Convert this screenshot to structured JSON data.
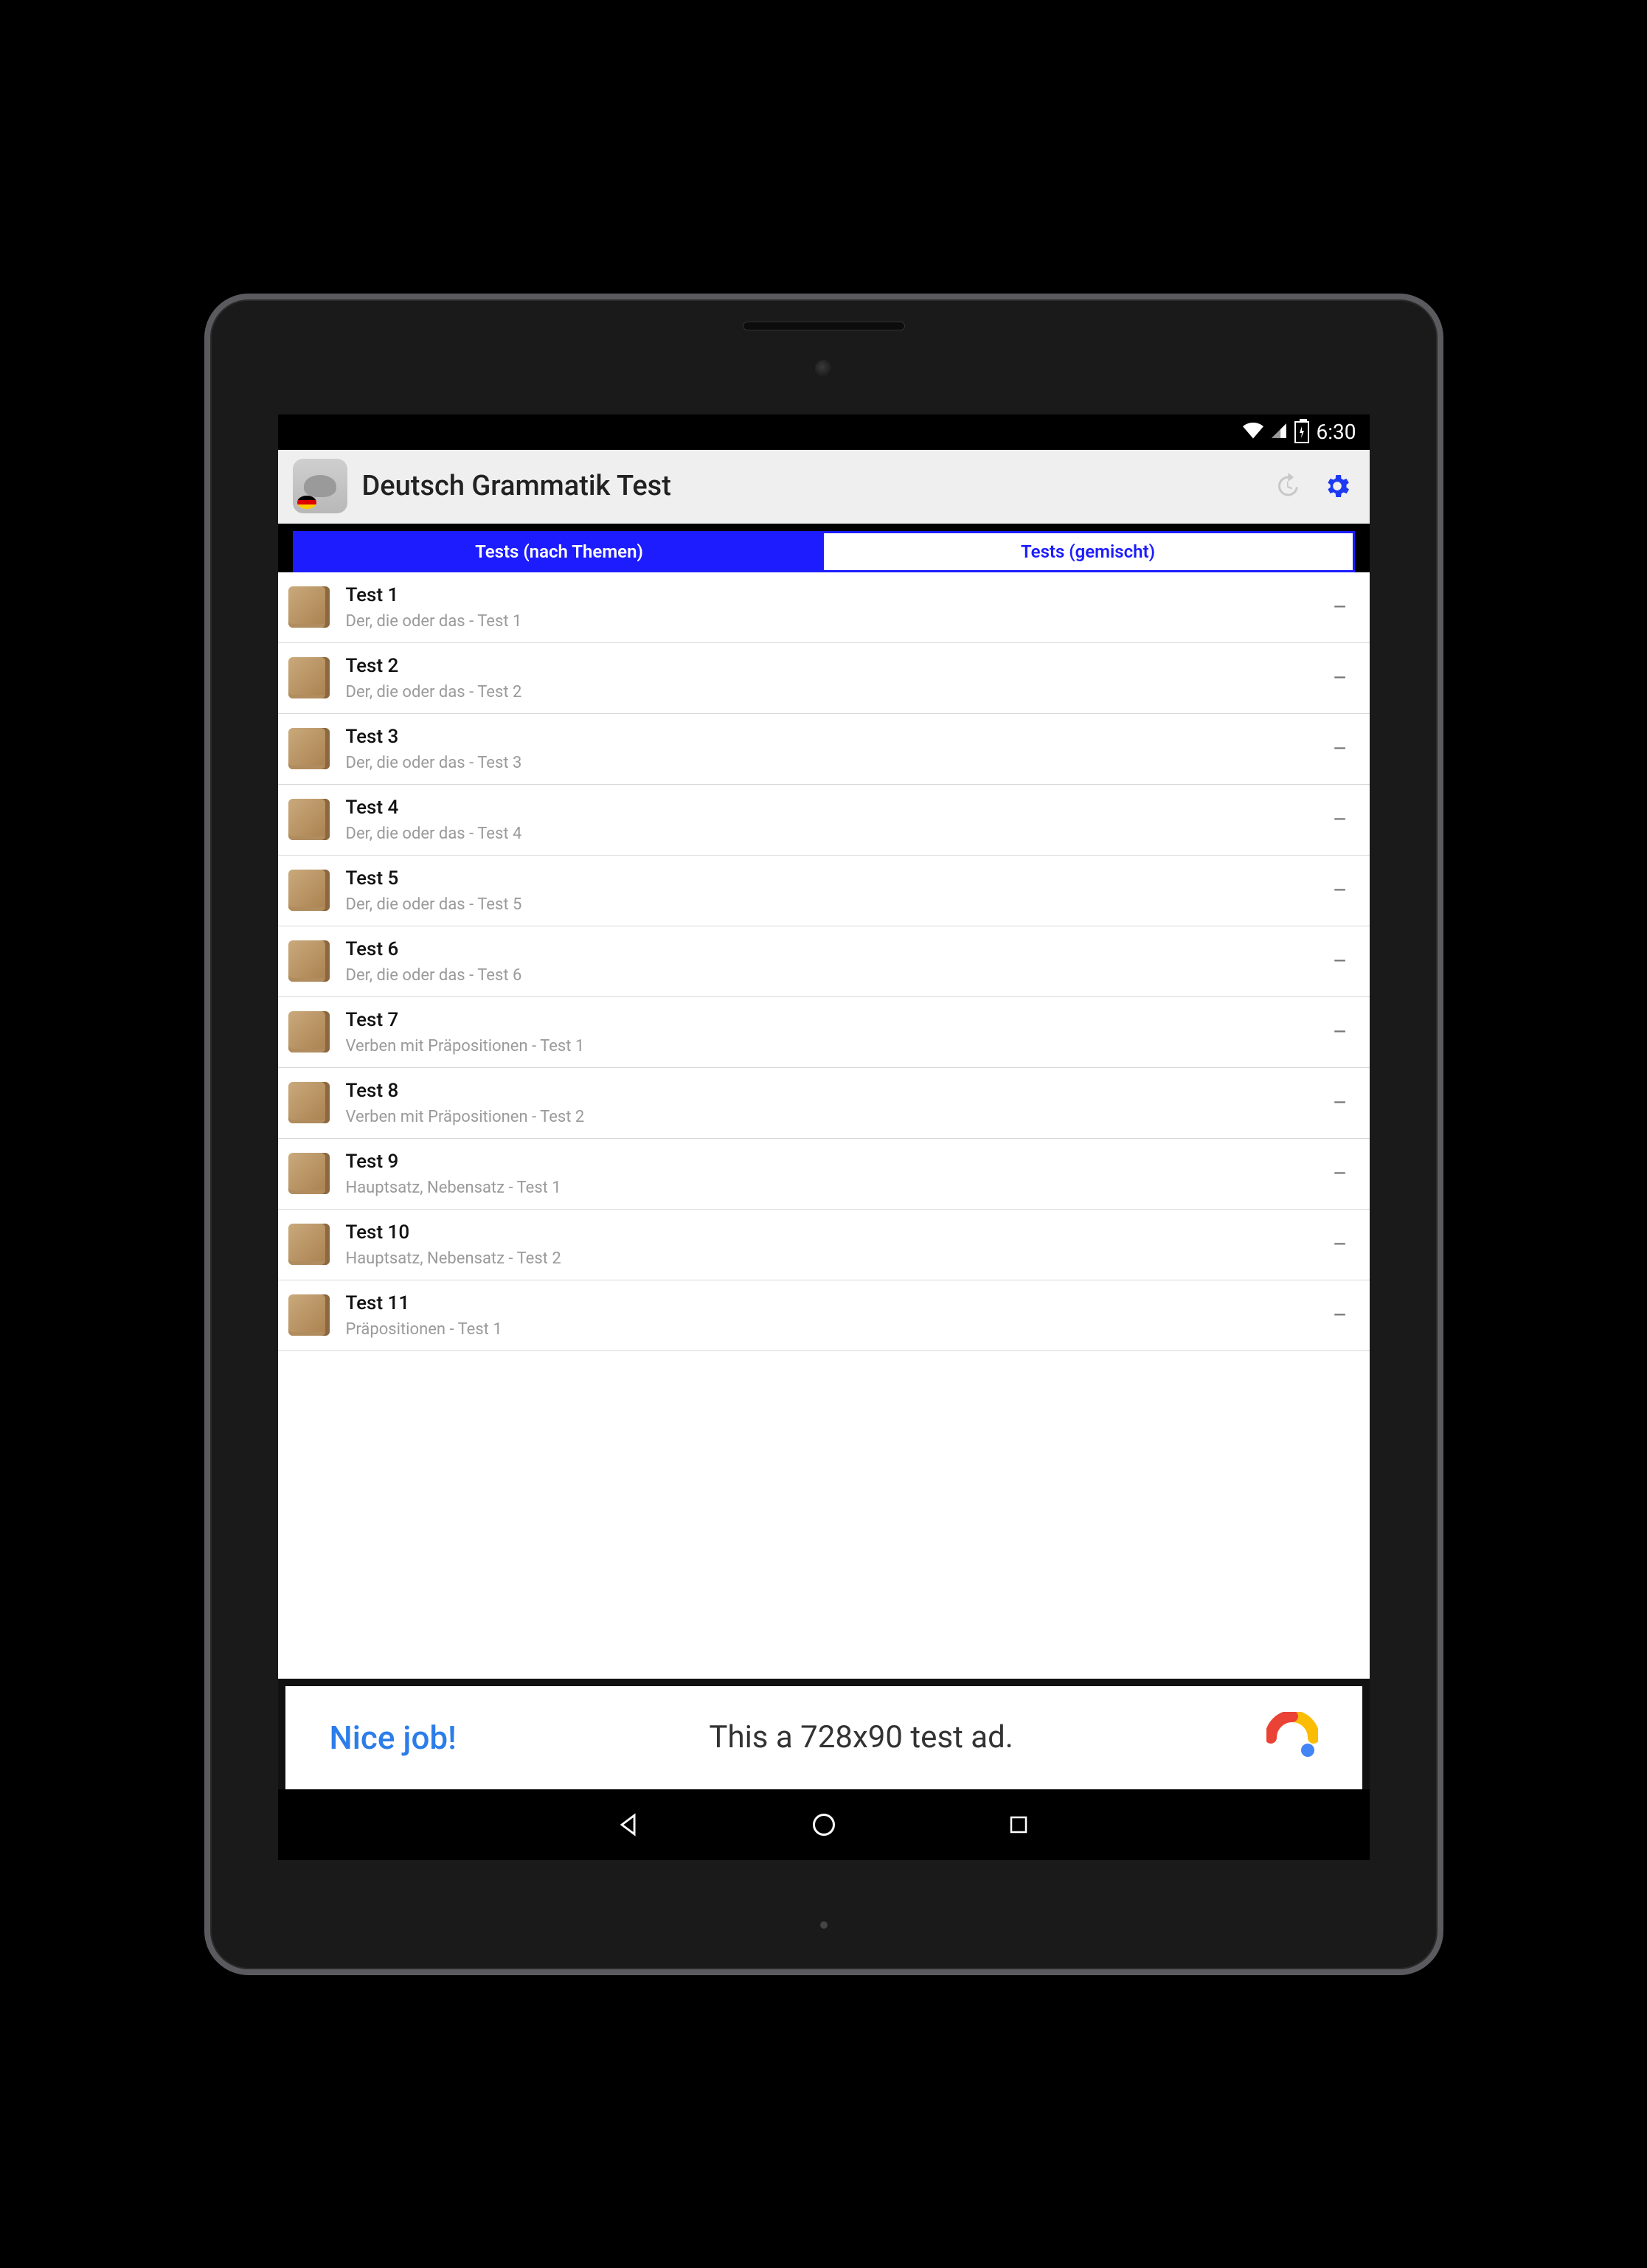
{
  "statusbar": {
    "time": "6:30"
  },
  "actionbar": {
    "title": "Deutsch Grammatik Test"
  },
  "tabs": {
    "left": "Tests (nach Themen)",
    "right": "Tests (gemischt)",
    "active_index": 0
  },
  "list": [
    {
      "title": "Test 1",
      "subtitle": "Der, die oder das - Test 1",
      "trail": "–"
    },
    {
      "title": "Test 2",
      "subtitle": "Der, die oder das - Test 2",
      "trail": "–"
    },
    {
      "title": "Test 3",
      "subtitle": "Der, die oder das - Test 3",
      "trail": "–"
    },
    {
      "title": "Test 4",
      "subtitle": "Der, die oder das - Test 4",
      "trail": "–"
    },
    {
      "title": "Test 5",
      "subtitle": "Der, die oder das - Test 5",
      "trail": "–"
    },
    {
      "title": "Test 6",
      "subtitle": "Der, die oder das - Test 6",
      "trail": "–"
    },
    {
      "title": "Test 7",
      "subtitle": "Verben mit Präpositionen - Test 1",
      "trail": "–"
    },
    {
      "title": "Test 8",
      "subtitle": "Verben mit Präpositionen - Test 2",
      "trail": "–"
    },
    {
      "title": "Test 9",
      "subtitle": "Hauptsatz, Nebensatz - Test 1",
      "trail": "–"
    },
    {
      "title": "Test 10",
      "subtitle": "Hauptsatz, Nebensatz - Test 2",
      "trail": "–"
    },
    {
      "title": "Test 11",
      "subtitle": "Präpositionen - Test 1",
      "trail": "–"
    }
  ],
  "ad": {
    "nice": "Nice job!",
    "msg": "This a 728x90 test ad."
  }
}
